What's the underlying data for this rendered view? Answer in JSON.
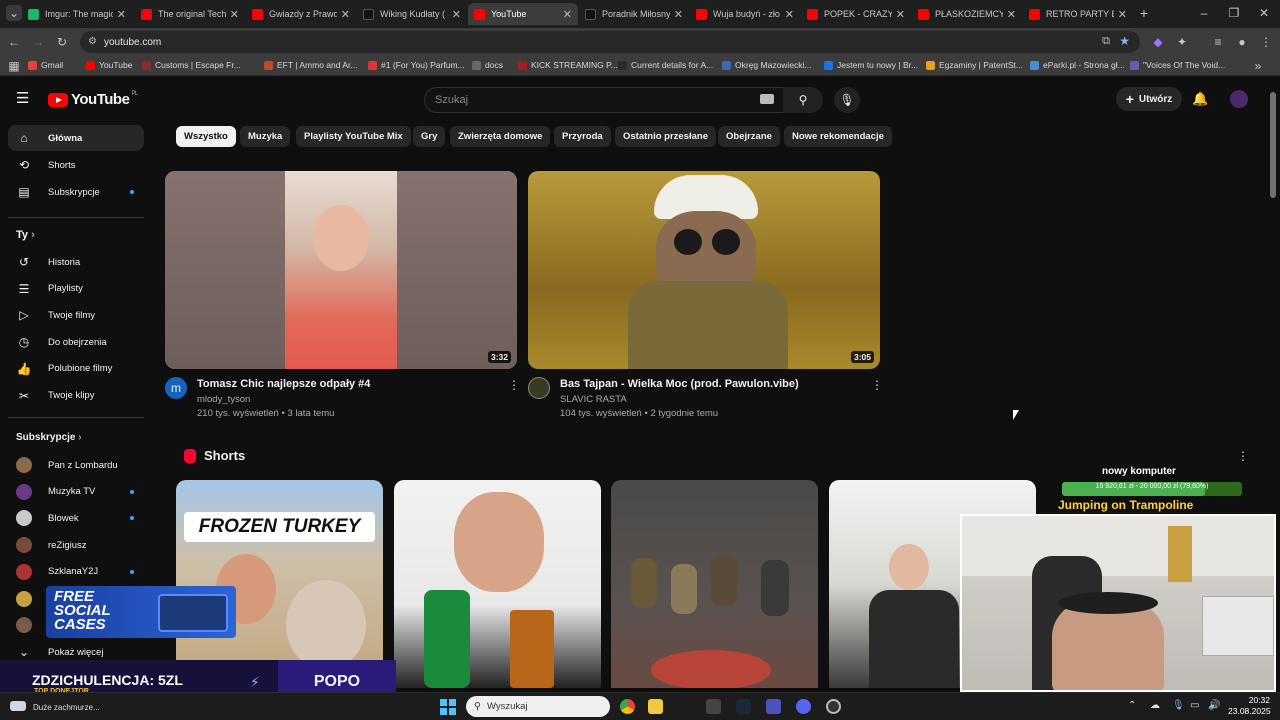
{
  "browser": {
    "tabs": [
      {
        "label": "Imgur: The magic",
        "kind": "img"
      },
      {
        "label": "The original Techn",
        "kind": "yt"
      },
      {
        "label": "Gwiazdy z Prawd",
        "kind": "yt"
      },
      {
        "label": "Wiking Kudłaty (",
        "kind": "tt"
      },
      {
        "label": "YouTube",
        "kind": "yt",
        "active": true
      },
      {
        "label": "Poradnik Miłosny",
        "kind": "tt"
      },
      {
        "label": "Wuja budyń - zło",
        "kind": "yt"
      },
      {
        "label": "POPEK - CRAZY (",
        "kind": "yt"
      },
      {
        "label": "PŁASKOZIEMCY O",
        "kind": "yt"
      },
      {
        "label": "RETRO PARTY EN",
        "kind": "yt"
      }
    ],
    "url": "youtube.com",
    "bookmarks": [
      "Gmail",
      "YouTube",
      "Customs | Escape Fr...",
      "EFT | Ammo and Ar...",
      "#1 (For You) Parfum...",
      "docs",
      "KICK STREAMING P...",
      "Current details for A...",
      "Okręg Mazowiecki...",
      "Jestem tu nowy | Br...",
      "Egzaminy | PatentSt...",
      "eParki.pl - Strona gł...",
      "\"Voices Of The Void..."
    ]
  },
  "youtube": {
    "logo_text": "YouTube",
    "logo_region": "PL",
    "search_placeholder": "Szukaj",
    "create_label": "Utwórz",
    "sidebar": {
      "main": [
        {
          "label": "Główna",
          "icon": "home-icon",
          "selected": true
        },
        {
          "label": "Shorts",
          "icon": "shorts-icon"
        },
        {
          "label": "Subskrypcje",
          "icon": "subscriptions-icon",
          "dot": true
        }
      ],
      "you_heading": "Ty",
      "you": [
        {
          "label": "Historia",
          "icon": "history-icon"
        },
        {
          "label": "Playlisty",
          "icon": "playlist-icon"
        },
        {
          "label": "Twoje filmy",
          "icon": "video-icon"
        },
        {
          "label": "Do obejrzenia",
          "icon": "clock-icon"
        },
        {
          "label": "Polubione filmy",
          "icon": "thumbs-up-icon"
        },
        {
          "label": "Twoje klipy",
          "icon": "scissors-icon"
        }
      ],
      "subs_heading": "Subskrypcje",
      "subs": [
        {
          "label": "Pan z Lombardu",
          "color": "#8a6a4a"
        },
        {
          "label": "Muzyka TV",
          "color": "#6a3a8a",
          "dot": true
        },
        {
          "label": "Blowek",
          "color": "#c9c9c9",
          "dot": true
        },
        {
          "label": "reZigiusz",
          "color": "#7a4a3a"
        },
        {
          "label": "SzklanaY2J",
          "color": "#a33",
          "dot": true
        },
        {
          "label": "",
          "color": "#c8a040"
        },
        {
          "label": "",
          "color": "#7a5a4a"
        }
      ],
      "show_more": "Pokaż więcej"
    },
    "chips": [
      "Wszystko",
      "Muzyka",
      "Playlisty YouTube Mix",
      "Gry",
      "Zwierzęta domowe",
      "Przyroda",
      "Ostatnio przesłane",
      "Obejrzane",
      "Nowe rekomendacje"
    ],
    "videos": [
      {
        "title": "Tomasz Chic najlepsze odpały #4",
        "channel": "mlody_tyson",
        "meta": "210 tys. wyświetleń • 3 lata temu",
        "duration": "3:32",
        "avatar_letter": "m"
      },
      {
        "title": "Bas Tajpan - Wielka Moc (prod. Pawulon.vibe)",
        "channel": "SLAVIC RASTA",
        "meta": "104 tys. wyświetleń • 2 tygodnie temu",
        "duration": "3:05",
        "avatar_letter": ""
      }
    ],
    "shorts_heading": "Shorts",
    "shorts_first_text": "FROZEN TURKEY"
  },
  "stream": {
    "cases_text": "FREE SOCIAL CASES",
    "bar_left": "ZDZICHULENCJA: 5ZL",
    "bar_sub": "TOP DONEJTOR",
    "bar_right": "POPO",
    "donate_heading": "nowy komputer",
    "donate_progress": "15 920,61 zł - 20 000,00 zł (79,60%)",
    "donate_fraction": 0.796,
    "donate_caption": "Jumping on Trampoline"
  },
  "taskbar": {
    "weather": "Duże zachmurze...",
    "search_placeholder": "Wyszukaj",
    "time": "20:32",
    "date": "23.08.2025"
  }
}
